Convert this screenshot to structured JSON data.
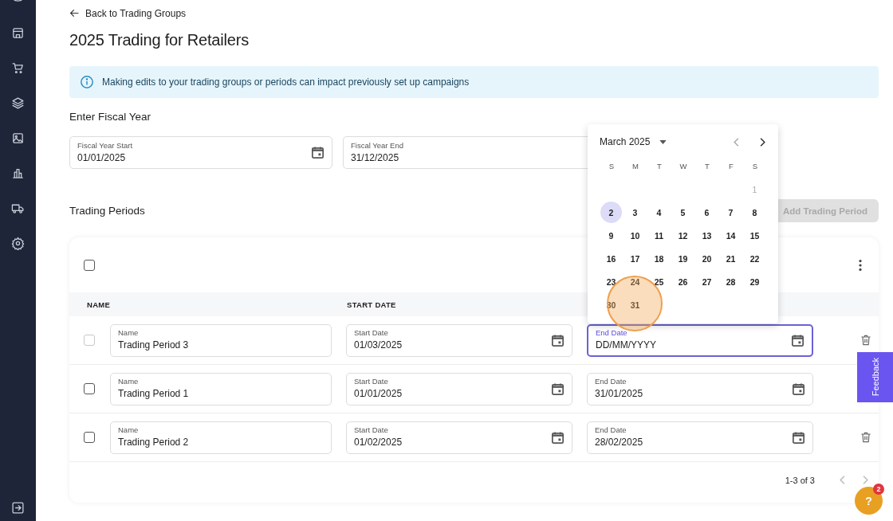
{
  "back_link": "Back to Trading Groups",
  "title": "2025 Trading for Retailers",
  "banner": "Making edits to your trading groups or periods can impact previously set up campaigns",
  "fiscal": {
    "heading": "Enter Fiscal Year",
    "fields": [
      {
        "label": "Fiscal Year Start",
        "value": "01/01/2025"
      },
      {
        "label": "Fiscal Year End",
        "value": "31/12/2025"
      }
    ]
  },
  "periods": {
    "heading": "Trading Periods",
    "add_button": {
      "label": "Add Trading Period",
      "disabled": true
    },
    "select_all": {
      "checked": false
    },
    "columns": [
      "NAME",
      "START DATE"
    ],
    "rows": [
      {
        "checked": false,
        "disabled": true,
        "name": {
          "label": "Name",
          "value": "Trading Period 3"
        },
        "start": {
          "label": "Start Date",
          "value": "01/03/2025"
        },
        "end": {
          "label": "End Date",
          "placeholder": "DD/MM/YYYY",
          "focused": true
        }
      },
      {
        "checked": false,
        "disabled": false,
        "name": {
          "label": "Name",
          "value": "Trading Period 1"
        },
        "start": {
          "label": "Start Date",
          "value": "01/01/2025"
        },
        "end": {
          "label": "End Date",
          "value": "31/01/2025",
          "focused": false
        }
      },
      {
        "checked": false,
        "disabled": false,
        "name": {
          "label": "Name",
          "value": "Trading Period 2"
        },
        "start": {
          "label": "Start Date",
          "value": "01/02/2025"
        },
        "end": {
          "label": "End Date",
          "value": "28/02/2025",
          "focused": false
        }
      }
    ],
    "pagination": "1-3 of 3"
  },
  "calendar": {
    "month": "March 2025",
    "weekdays": [
      "S",
      "M",
      "T",
      "W",
      "T",
      "F",
      "S"
    ],
    "weeks": [
      [
        {
          "label": "1",
          "disabled": true,
          "highlighted": false
        }
      ],
      [
        {
          "label": "2",
          "disabled": false,
          "highlighted": true
        },
        {
          "label": "3",
          "disabled": false,
          "highlighted": false
        },
        {
          "label": "4",
          "disabled": false,
          "highlighted": false
        },
        {
          "label": "5",
          "disabled": false,
          "highlighted": false
        },
        {
          "label": "6",
          "disabled": false,
          "highlighted": false
        },
        {
          "label": "7",
          "disabled": false,
          "highlighted": false
        },
        {
          "label": "8",
          "disabled": false,
          "highlighted": false
        }
      ],
      [
        {
          "label": "9",
          "disabled": false,
          "highlighted": false
        },
        {
          "label": "10",
          "disabled": false,
          "highlighted": false
        },
        {
          "label": "11",
          "disabled": false,
          "highlighted": false
        },
        {
          "label": "12",
          "disabled": false,
          "highlighted": false
        },
        {
          "label": "13",
          "disabled": false,
          "highlighted": false
        },
        {
          "label": "14",
          "disabled": false,
          "highlighted": false
        },
        {
          "label": "15",
          "disabled": false,
          "highlighted": false
        }
      ],
      [
        {
          "label": "16",
          "disabled": false,
          "highlighted": false
        },
        {
          "label": "17",
          "disabled": false,
          "highlighted": false
        },
        {
          "label": "18",
          "disabled": false,
          "highlighted": false
        },
        {
          "label": "19",
          "disabled": false,
          "highlighted": false
        },
        {
          "label": "20",
          "disabled": false,
          "highlighted": false
        },
        {
          "label": "21",
          "disabled": false,
          "highlighted": false
        },
        {
          "label": "22",
          "disabled": false,
          "highlighted": false
        }
      ],
      [
        {
          "label": "23",
          "disabled": false,
          "highlighted": false
        },
        {
          "label": "24",
          "disabled": false,
          "highlighted": false
        },
        {
          "label": "25",
          "disabled": false,
          "highlighted": false
        },
        {
          "label": "26",
          "disabled": false,
          "highlighted": false
        },
        {
          "label": "27",
          "disabled": false,
          "highlighted": false
        },
        {
          "label": "28",
          "disabled": false,
          "highlighted": false
        },
        {
          "label": "29",
          "disabled": false,
          "highlighted": false
        }
      ],
      [
        {
          "label": "30",
          "disabled": false,
          "highlighted": false
        },
        {
          "label": "31",
          "disabled": false,
          "highlighted": false
        }
      ]
    ]
  },
  "feedback_tab": "Feedback",
  "help": {
    "badge": "2",
    "label": "?"
  }
}
